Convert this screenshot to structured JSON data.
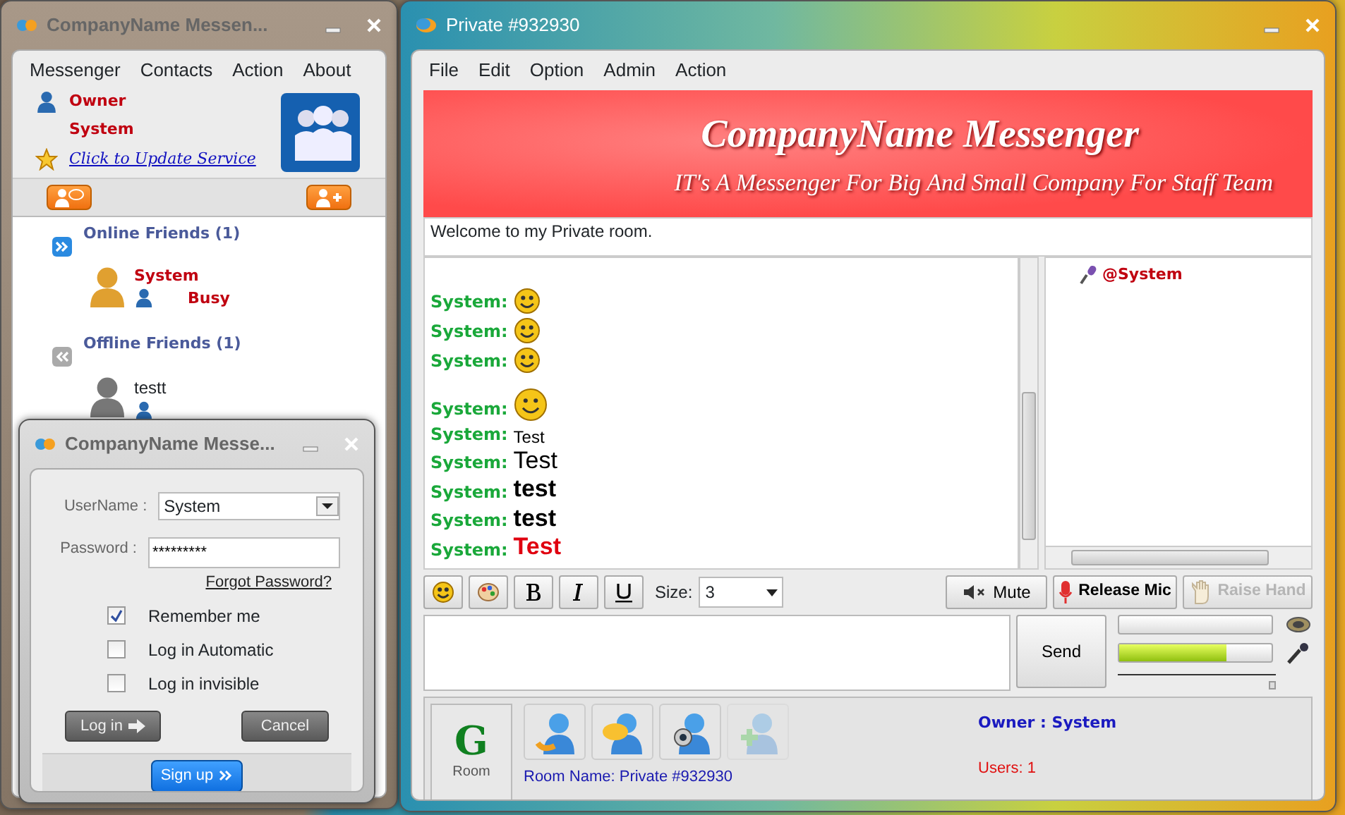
{
  "contacts_window": {
    "title": "CompanyName Messen...",
    "menu": [
      "Messenger",
      "Contacts",
      "Action",
      "About"
    ],
    "owner_label": "Owner",
    "owner_name": "System",
    "update_link": "Click to Update Service",
    "groups": [
      {
        "label": "Online Friends (1)",
        "expanded": true,
        "friends": [
          {
            "name": "System",
            "status": "Busy",
            "online": true
          }
        ]
      },
      {
        "label": "Offline Friends (1)",
        "expanded": false,
        "friends": [
          {
            "name": "testt",
            "online": false
          }
        ]
      }
    ]
  },
  "login_window": {
    "title": "CompanyName Messe...",
    "username_label": "UserName :",
    "username": "System",
    "password_label": "Password :",
    "password": "*********",
    "forgot_link": "Forgot Password?",
    "checkboxes": [
      {
        "label": "Remember me",
        "checked": true
      },
      {
        "label": "Log in Automatic",
        "checked": false
      },
      {
        "label": "Log in invisible",
        "checked": false
      }
    ],
    "login_button": "Log in",
    "cancel_button": "Cancel",
    "signup_button": "Sign up"
  },
  "chat_window": {
    "title": "Private #932930",
    "menu": [
      "File",
      "Edit",
      "Option",
      "Admin",
      "Action"
    ],
    "banner_title": "CompanyName Messenger",
    "banner_subtitle": "IT's A Messenger For Big And Small Company For Staff Team",
    "welcome": "Welcome to my Private room.",
    "messages": [
      {
        "sender": "System:",
        "kind": "emoticon"
      },
      {
        "sender": "System:",
        "kind": "emoticon"
      },
      {
        "sender": "System:",
        "kind": "emoticon"
      },
      {
        "sender": "System:",
        "kind": "emoticon"
      },
      {
        "sender": "System:",
        "kind": "plain",
        "text": "Test"
      },
      {
        "sender": "System:",
        "kind": "large",
        "text": "Test"
      },
      {
        "sender": "System:",
        "kind": "bold",
        "text": "test"
      },
      {
        "sender": "System:",
        "kind": "bold",
        "text": "test"
      },
      {
        "sender": "System:",
        "kind": "highlight",
        "text": "Test"
      }
    ],
    "users": [
      {
        "name": "@System"
      }
    ],
    "size_label": "Size:",
    "size_value": "3",
    "mute_button": "Mute",
    "release_mic_button": "Release Mic",
    "raise_hand": {
      "label": "Raise Hand",
      "disabled": true
    },
    "send_button": "Send",
    "speaker_meter": {
      "level": 0
    },
    "mic_meter": {
      "level": 0.7
    },
    "volume_slider": {
      "level": 1
    },
    "room_logo": "G",
    "room_button": "Room",
    "actions": [
      {
        "disabled": false
      },
      {
        "disabled": false
      },
      {
        "disabled": false
      },
      {
        "disabled": true
      }
    ],
    "room_name": "Room Name: Private #932930",
    "owner": "Owner : System",
    "users_count": "Users: 1"
  }
}
